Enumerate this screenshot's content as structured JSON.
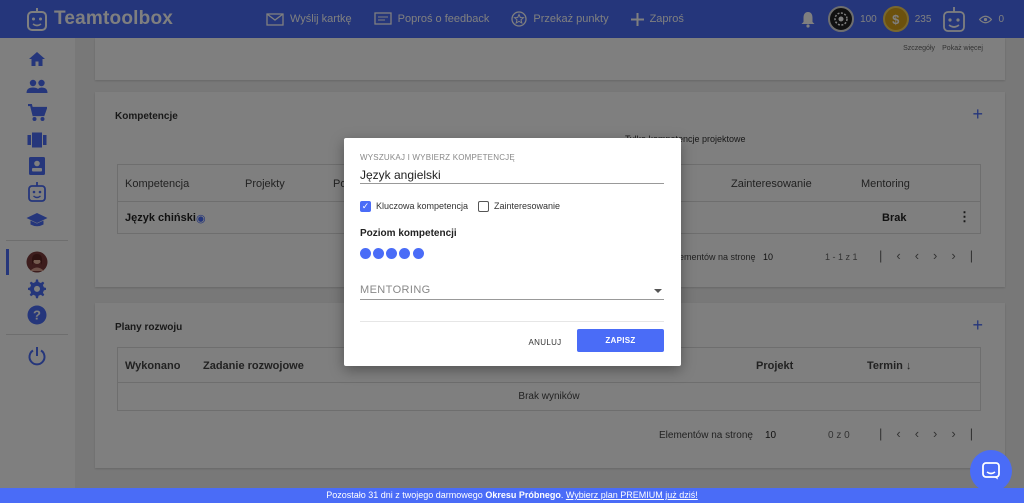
{
  "app": {
    "name": "Teamtoolbox"
  },
  "nav": {
    "send_card": "Wyślij kartkę",
    "ask_feedback": "Poproś o feedback",
    "give_points": "Przekaż punkty",
    "invite": "Zaproś"
  },
  "top": {
    "points_dark": "100",
    "points_gold": "235",
    "views": "0"
  },
  "card1": {
    "details": "Szczegóły",
    "show_more": "Pokaż więcej"
  },
  "competences": {
    "title": "Kompetencje",
    "filter_project": "Tylko kompetencje projektowe",
    "columns": [
      "Kompetencja",
      "Projekty",
      "Po",
      "Zainteresowanie",
      "Mentoring"
    ],
    "rows": [
      {
        "name": "Język chiński",
        "mentoring": "Brak"
      }
    ],
    "per_page_label": "lementów na stronę",
    "per_page": "10",
    "range": "1 - 1 z 1"
  },
  "plans": {
    "title": "Plany rozwoju",
    "columns": [
      "Wykonano",
      "Zadanie rozwojowe",
      "Projekt",
      "Termin ↓"
    ],
    "empty": "Brak wyników",
    "per_page_label": "Elementów na stronę",
    "per_page": "10",
    "range": "0 z 0"
  },
  "modal": {
    "search_label": "WYSZUKAJ I WYBIERZ KOMPETENCJĘ",
    "search_value": "Język angielski",
    "key_competence": "Kluczowa kompetencja",
    "interest": "Zainteresowanie",
    "level_title": "Poziom kompetencji",
    "level": 5,
    "mentoring_placeholder": "MENTORING",
    "cancel": "ANULUJ",
    "save": "ZAPISZ"
  },
  "banner": {
    "text_before": "Pozostało 31 dni z twojego darmowego ",
    "bold": "Okresu Próbnego",
    "text_middle": ". ",
    "link": "Wybierz plan PREMIUM już dziś!"
  },
  "colors": {
    "brand": "#4a6cf7"
  }
}
